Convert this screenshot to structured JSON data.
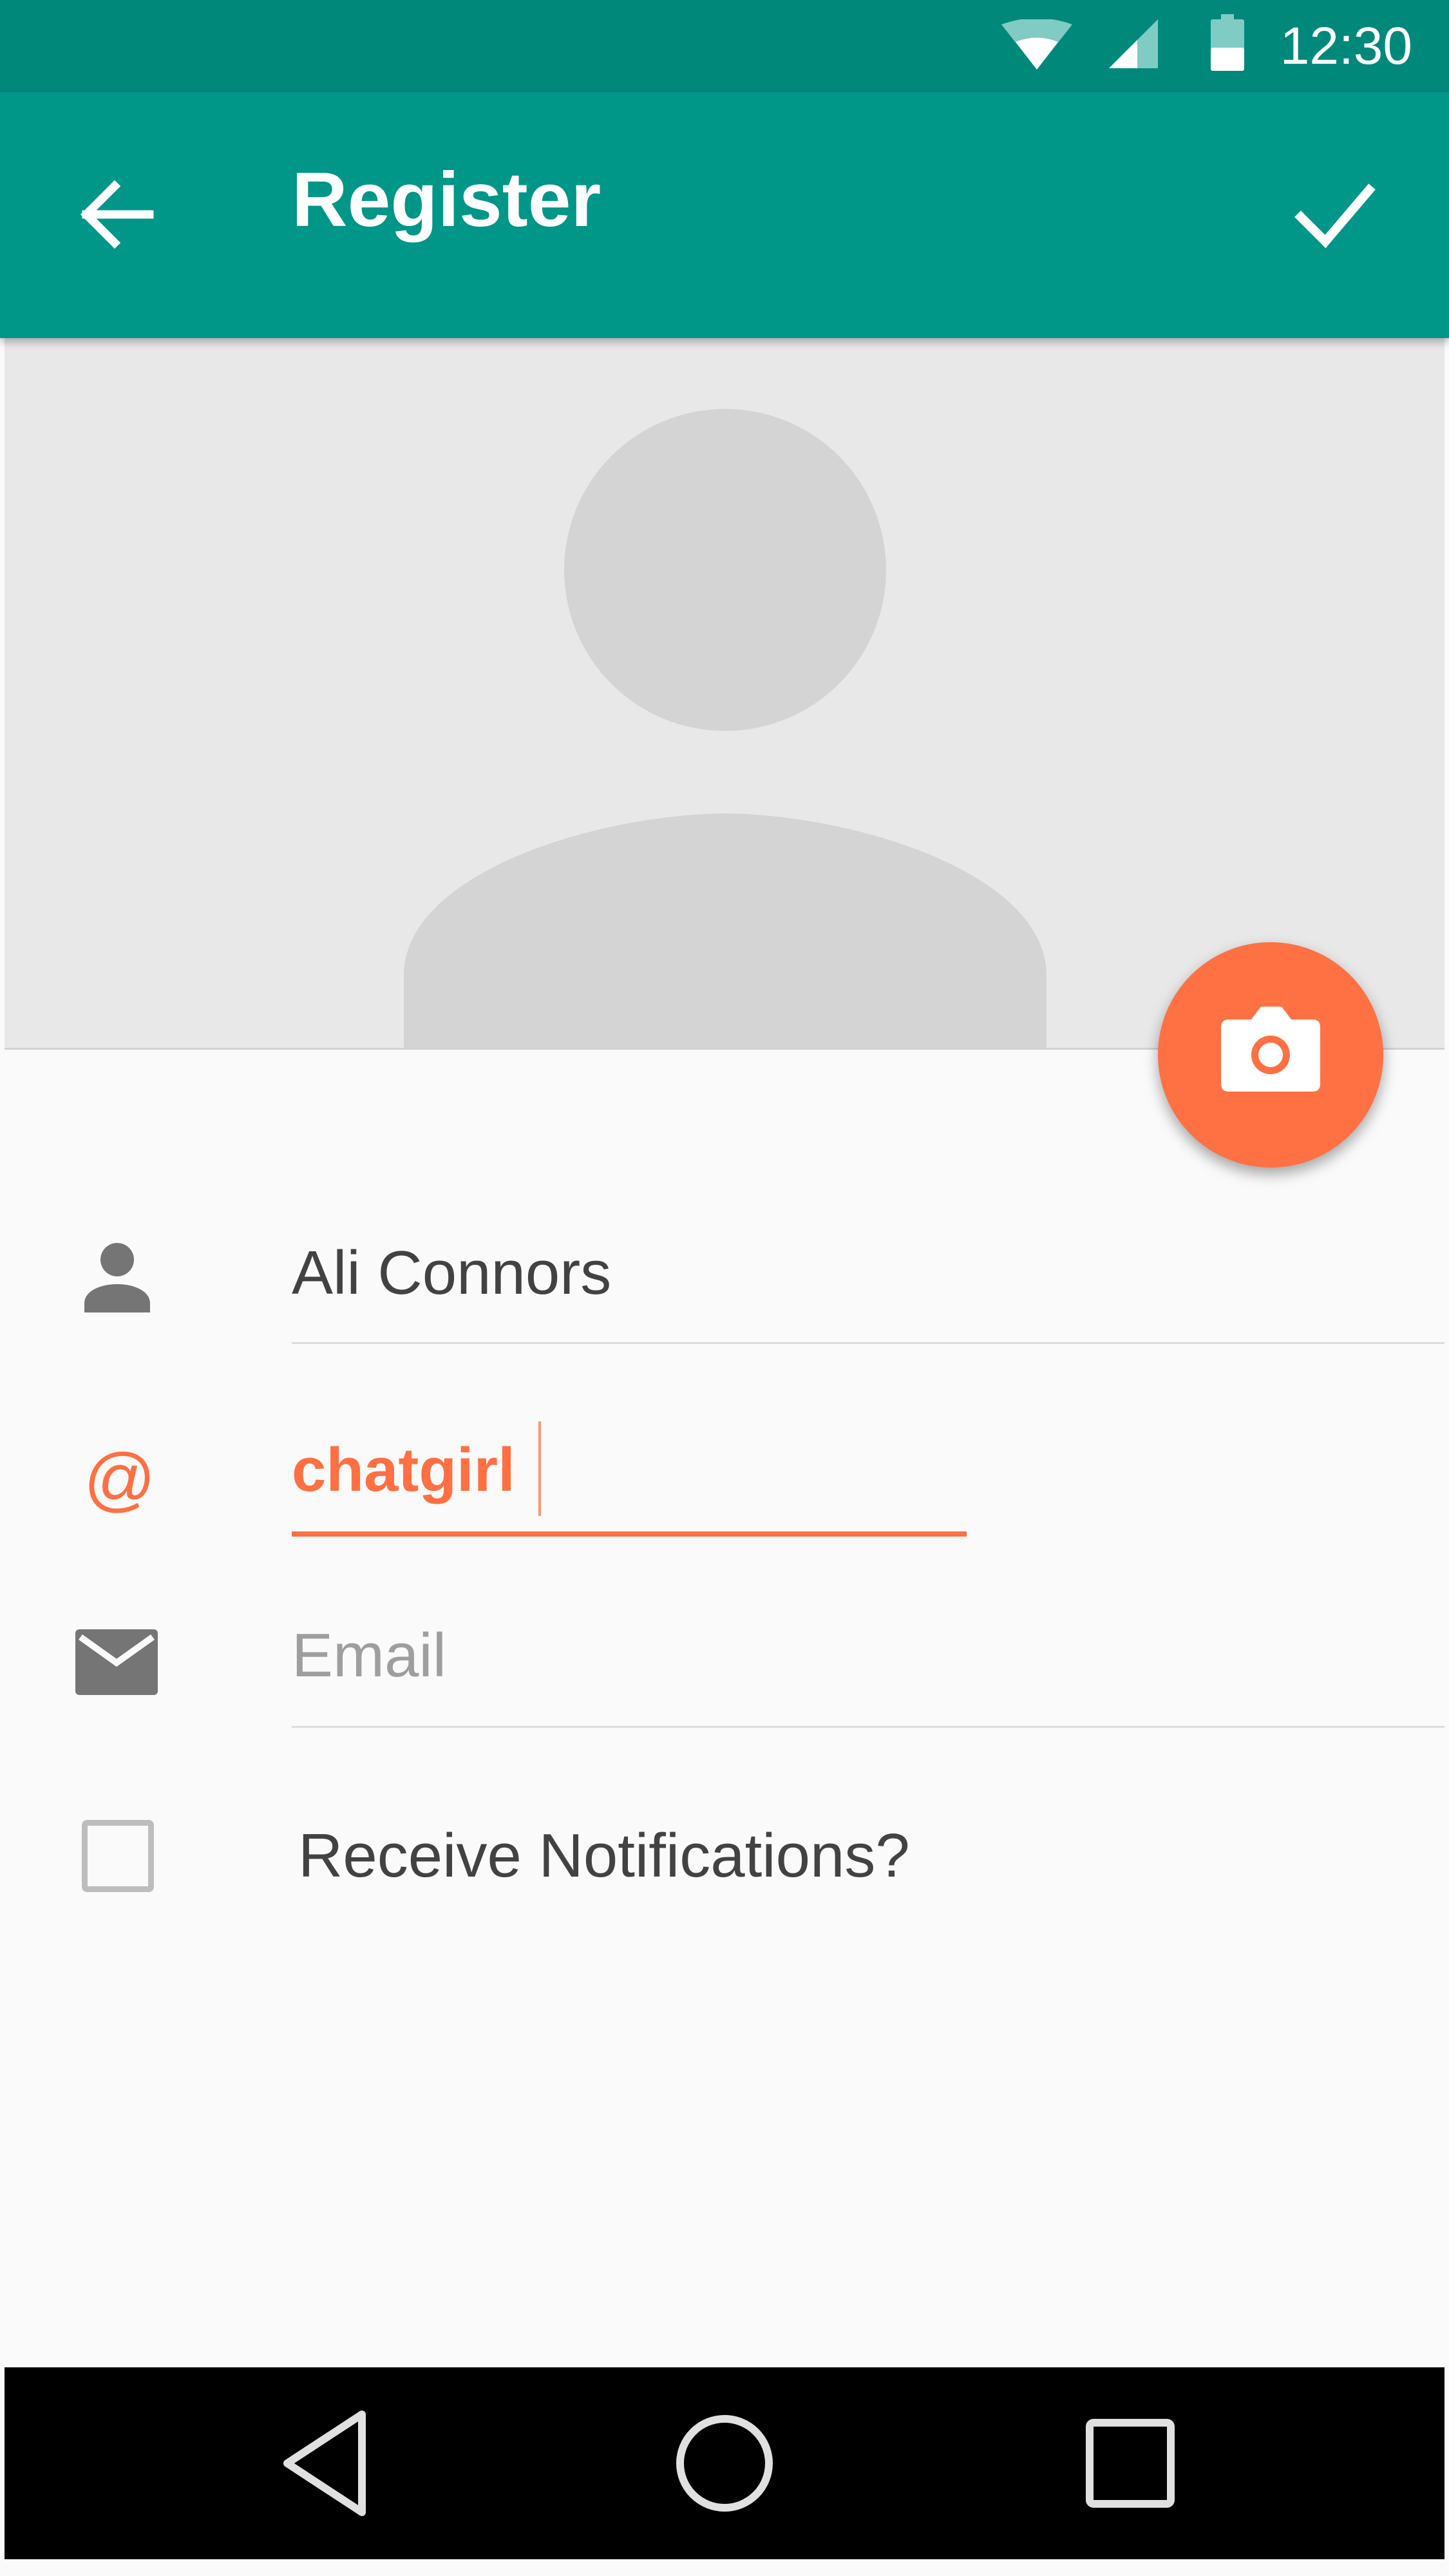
{
  "status_bar": {
    "time": "12:30",
    "icons": [
      "wifi-icon",
      "signal-icon",
      "battery-icon"
    ]
  },
  "app_bar": {
    "title": "Register",
    "back_icon": "arrow-left-icon",
    "confirm_icon": "check-icon"
  },
  "header": {
    "avatar_icon": "person-placeholder-icon",
    "fab_icon": "camera-icon"
  },
  "form": {
    "name": {
      "icon": "person-icon",
      "value": "Ali Connors"
    },
    "username": {
      "icon": "at-icon",
      "icon_text": "@",
      "value": "chatgirl"
    },
    "email": {
      "icon": "mail-icon",
      "value": "",
      "placeholder": "Email"
    },
    "notifications": {
      "label": "Receive Notifications?",
      "checked": false
    }
  },
  "nav_bar": {
    "icons": [
      "back-triangle-icon",
      "home-circle-icon",
      "recents-square-icon"
    ]
  },
  "colors": {
    "status_bar": "#00897b",
    "app_bar": "#009688",
    "accent": "#ff7043",
    "header_bg": "#e8e8e8",
    "avatar": "#d4d4d4"
  }
}
